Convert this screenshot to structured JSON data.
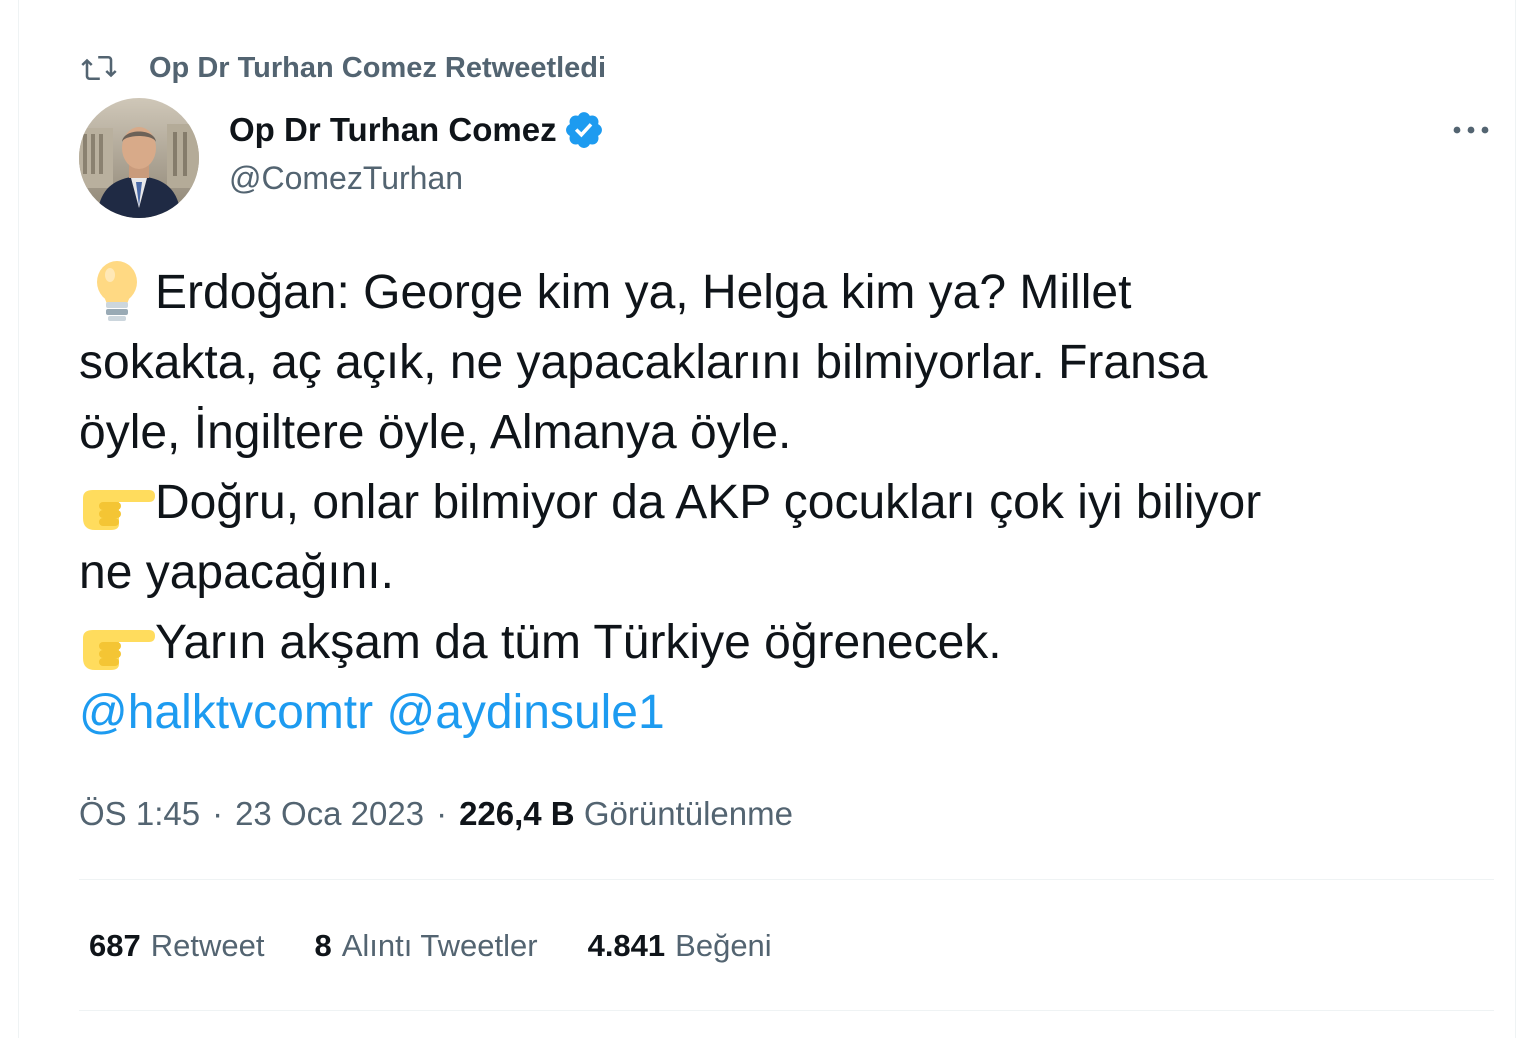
{
  "retweet_header": {
    "icon": "retweet-icon",
    "text": "Op Dr Turhan Comez Retweetledi"
  },
  "author": {
    "name": "Op Dr Turhan Comez",
    "handle": "@ComezTurhan",
    "verified_icon": "verified-badge-icon",
    "verified_color": "#1d9bf0"
  },
  "more_icon": "more-options-icon",
  "tweet": {
    "lines": [
      {
        "emoji": "light-bulb-emoji",
        "text": "Erdoğan: George kim ya, Helga kim ya? Millet"
      },
      {
        "text": "sokakta, aç açık, ne yapacaklarını bilmiyorlar. Fransa"
      },
      {
        "text": "öyle, İngiltere öyle, Almanya öyle."
      },
      {
        "emoji": "pointing-right-emoji",
        "text": "Doğru, onlar bilmiyor da AKP çocukları çok iyi biliyor"
      },
      {
        "text": "ne yapacağını."
      },
      {
        "emoji": "pointing-right-emoji",
        "text": "Yarın akşam da tüm Türkiye öğrenecek."
      }
    ],
    "mentions": [
      "@halktvcomtr",
      "@aydinsule1"
    ],
    "mention_color": "#1d9bf0"
  },
  "meta": {
    "time": "ÖS 1:45",
    "separator": "·",
    "date": "23 Oca 2023",
    "views_count": "226,4 B",
    "views_label": "Görüntülenme"
  },
  "stats": {
    "retweets_count": "687",
    "retweets_label": "Retweet",
    "quotes_count": "8",
    "quotes_label": "Alıntı Tweetler",
    "likes_count": "4.841",
    "likes_label": "Beğeni"
  },
  "colors": {
    "text_primary": "#0f1419",
    "text_secondary": "#536471",
    "divider": "#eff3f4"
  }
}
